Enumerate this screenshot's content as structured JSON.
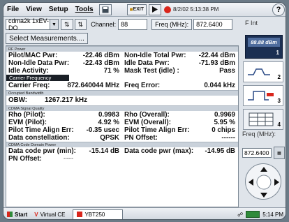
{
  "menubar": {
    "file": "File",
    "view": "View",
    "setup": "Setup",
    "tools": "Tools",
    "exit_button": "EXIT",
    "datetime": "8/2/02 5:13:38 PM",
    "help": "?"
  },
  "toolbar": {
    "mode_select": "cdma2k 1xEV-DO",
    "channel_label": "Channel:",
    "channel_value": "88",
    "freq_label": "Freq (MHz):",
    "freq_value": "872.6400"
  },
  "select_measurements": "Select Measurements....",
  "sections": {
    "rf_power": "RF Power",
    "carrier_frequency": "Carrier Frequency",
    "occupied_bandwidth": "Occupied Bandwidth",
    "signal_quality": "CDMA Signal Quality",
    "code_domain": "CDMA Code Domain Power"
  },
  "rf_power": {
    "pilot_mac_label": "Pilot/MAC Pwr:",
    "pilot_mac_value": "-22.46 dBm",
    "nonidle_total_label": "Non-Idle Total Pwr:",
    "nonidle_total_value": "-22.44 dBm",
    "nonidle_data_label": "Non-Idle Data Pwr:",
    "nonidle_data_value": "-22.43 dBm",
    "idle_data_label": "Idle Data Pwr:",
    "idle_data_value": "-71.93 dBm",
    "idle_activity_label": "Idle Activity:",
    "idle_activity_value": "71 %",
    "mask_test_label": "Mask Test (idle) :",
    "mask_test_value": "Pass"
  },
  "carrier": {
    "carrier_freq_label": "Carrier Freq:",
    "carrier_freq_value": "872.640044 MHz",
    "freq_error_label": "Freq Error:",
    "freq_error_value": "0.044 kHz"
  },
  "obw": {
    "label": "OBW:",
    "value": "1267.217 kHz"
  },
  "quality": {
    "rho_pilot_label": "Rho (Pilot):",
    "rho_pilot_value": "0.9983",
    "rho_overall_label": "Rho (Overall):",
    "rho_overall_value": "0.9969",
    "evm_pilot_label": "EVM (Pilot):",
    "evm_pilot_value": "4.92 %",
    "evm_overall_label": "EVM (Overall):",
    "evm_overall_value": "5.95 %",
    "pilot_align_label": "Pilot Time Align Err:",
    "pilot_align_value": "-0.35 usec",
    "pilot_align_chips_label": "Pilot Time Align Err:",
    "pilot_align_chips_value": "0 chips",
    "constellation_label": "Data constellation:",
    "constellation_value": "QPSK",
    "pn_offset_label": "PN Offset:",
    "pn_offset_value": "------"
  },
  "code_domain": {
    "min_label": "Data code pwr (min):",
    "min_value": "-15.14 dB",
    "max_label": "Data code pwr (max):",
    "max_value": "-14.95 dB",
    "pn_label": "PN Offset:",
    "pn_value": "------"
  },
  "side": {
    "display_text": "88.88 dBm",
    "display_num": "1",
    "btn2": "2",
    "btn3": "3",
    "btn4": "4",
    "freq_label": "Freq (MHz):",
    "freq_value": "872.6400",
    "top_icon_text": "F Int"
  },
  "taskbar": {
    "start": "Start",
    "virtual_ce": "Virtual CE",
    "app": "YBT250",
    "time": "5:14 PM"
  },
  "colors": {
    "accent_dark": "#1b2f52",
    "stop_red": "#d9261c",
    "header_gray": "#c9d1da"
  }
}
